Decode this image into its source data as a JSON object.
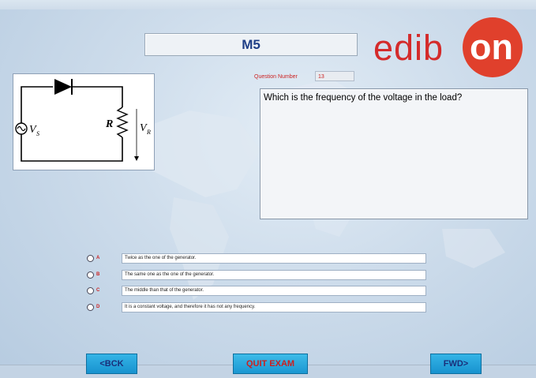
{
  "header": {
    "module_title": "M5"
  },
  "logo": {
    "wordmark_left": "edib",
    "wordmark_right": "on"
  },
  "circuit": {
    "source_label": "V",
    "source_sub": "S",
    "resistor_label": "R",
    "load_label": "V",
    "load_sub": "R"
  },
  "question": {
    "number_label": "Question Number",
    "number_value": "13",
    "text": "Which is the frequency of the voltage in the load?"
  },
  "answers": [
    {
      "letter": "A",
      "text": "Twice as the one of the generator."
    },
    {
      "letter": "B",
      "text": "The same one as the one of the generator."
    },
    {
      "letter": "C",
      "text": "The middle than that of the generator."
    },
    {
      "letter": "D",
      "text": "It is a constant voltage, and therefore it has not any frequency."
    }
  ],
  "nav": {
    "back_label": "<BCK",
    "quit_label": "QUIT EXAM",
    "forward_label": "FWD>"
  },
  "colors": {
    "accent_red": "#e0402c",
    "button_blue": "#1e9bd6",
    "title_blue": "#1f3f87"
  }
}
